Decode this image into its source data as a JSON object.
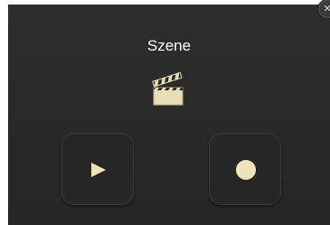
{
  "scene": {
    "title": "Szene",
    "icon": "clapperboard-icon",
    "controls": [
      {
        "name": "play-button",
        "icon": "play-icon"
      },
      {
        "name": "record-button",
        "icon": "record-icon"
      }
    ],
    "close_icon": "close-icon"
  },
  "colors": {
    "tile_background": "#2b2b2b",
    "button_background": "#262626",
    "glyph": "#efe4b8",
    "title_text": "#ffffff"
  }
}
